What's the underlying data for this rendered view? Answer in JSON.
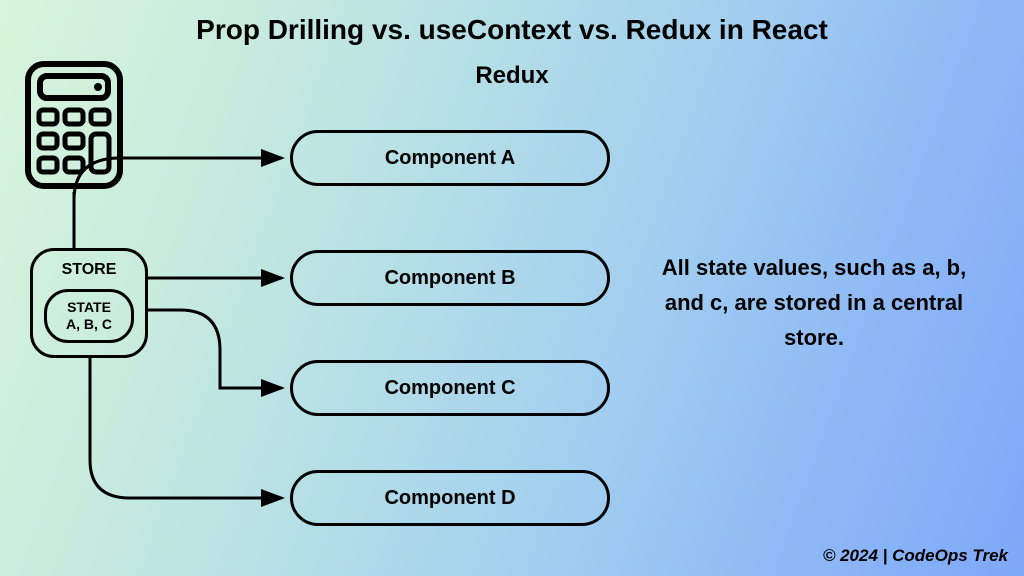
{
  "title": "Prop Drilling vs. useContext vs. Redux in React",
  "subtitle": "Redux",
  "store": {
    "label": "STORE",
    "state_label": "STATE",
    "state_values": "A, B, C"
  },
  "components": {
    "a": "Component A",
    "b": "Component B",
    "c": "Component C",
    "d": "Component D"
  },
  "description": "All state values, such as a, b, and c, are stored in a central store.",
  "footer": "© 2024 | CodeOps Trek"
}
